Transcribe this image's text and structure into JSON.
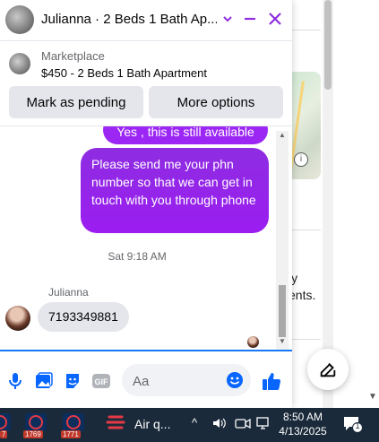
{
  "chat": {
    "title": "Julianna · 2 Beds 1 Bath Ap...",
    "listing_category": "Marketplace",
    "listing_title": "$450 - 2 Beds 1 Bath Apartment",
    "actions": [
      "Mark as pending",
      "More options"
    ],
    "messages": {
      "out_1": "Yes , this is still available",
      "out_2": "Please send me your phn number so that we can get in touch with you through phone",
      "timestamp": "Sat 9:18 AM",
      "sender": "Julianna",
      "in_1": "7193349881"
    },
    "composer": {
      "placeholder": "Aa",
      "icons": [
        "mic-icon",
        "photo-icon",
        "sticker-icon",
        "gif-icon",
        "emoji-icon",
        "like-icon"
      ],
      "gif_label": "GIF"
    }
  },
  "background": {
    "text_1": "ly",
    "text_2": "ents."
  },
  "taskbar": {
    "badges": [
      "7",
      "1769",
      "1771"
    ],
    "app_label": "Air q...",
    "time": "8:50 AM",
    "date": "4/13/2025",
    "notification_count": "1",
    "accent": "#1a2a3a"
  },
  "colors": {
    "messenger_purple": "#8e2de2",
    "link_blue": "#0866ff"
  }
}
